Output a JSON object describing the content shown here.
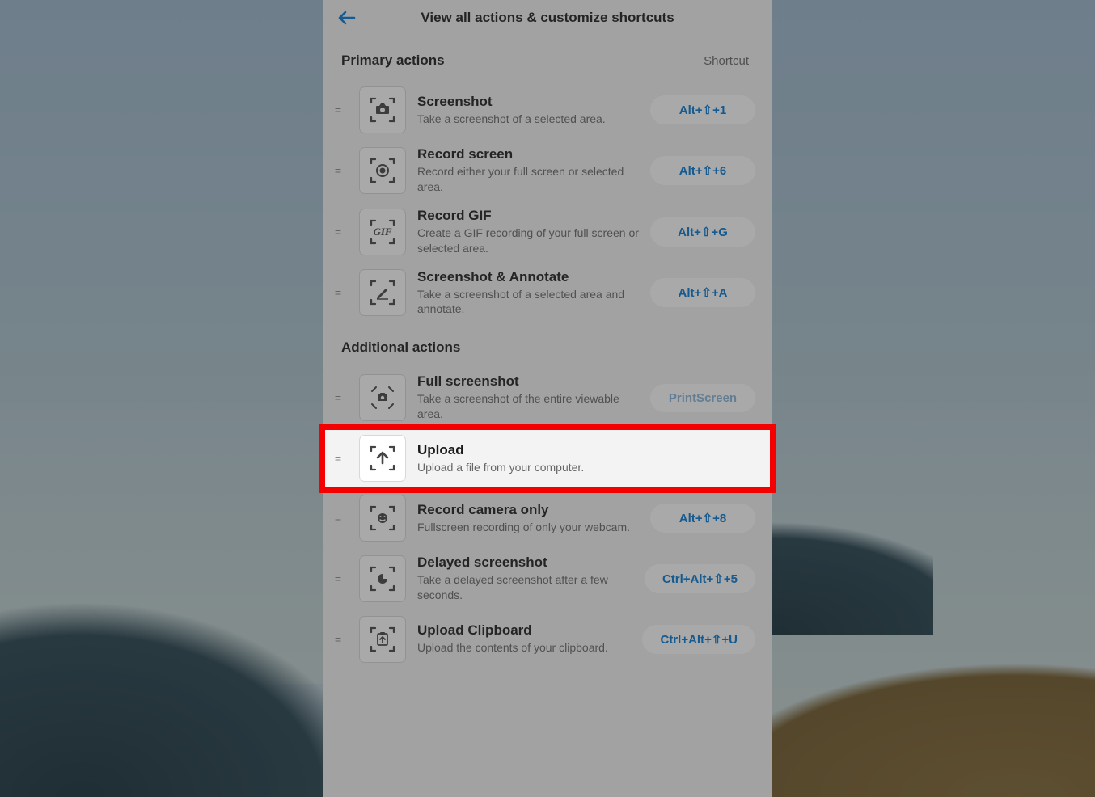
{
  "header": {
    "title": "View all actions & customize shortcuts"
  },
  "sections": {
    "primary": {
      "title": "Primary actions",
      "shortcut_col": "Shortcut"
    },
    "additional": {
      "title": "Additional actions"
    }
  },
  "actions": {
    "screenshot": {
      "title": "Screenshot",
      "desc": "Take a screenshot of a selected area.",
      "shortcut": "Alt+⇧+1"
    },
    "record_screen": {
      "title": "Record screen",
      "desc": "Record either your full screen or selected area.",
      "shortcut": "Alt+⇧+6"
    },
    "record_gif": {
      "title": "Record GIF",
      "desc": "Create a GIF recording of your full screen or selected area.",
      "shortcut": "Alt+⇧+G"
    },
    "screenshot_annotate": {
      "title": "Screenshot & Annotate",
      "desc": "Take a screenshot of a selected area and annotate.",
      "shortcut": "Alt+⇧+A"
    },
    "full_screenshot": {
      "title": "Full screenshot",
      "desc": "Take a screenshot of the entire viewable area.",
      "shortcut": "PrintScreen"
    },
    "upload": {
      "title": "Upload",
      "desc": "Upload a file from your computer."
    },
    "record_camera": {
      "title": "Record camera only",
      "desc": "Fullscreen recording of only your webcam.",
      "shortcut": "Alt+⇧+8"
    },
    "delayed_screenshot": {
      "title": "Delayed screenshot",
      "desc": "Take a delayed screenshot after a few seconds.",
      "shortcut": "Ctrl+Alt+⇧+5"
    },
    "upload_clipboard": {
      "title": "Upload Clipboard",
      "desc": "Upload the contents of your clipboard.",
      "shortcut": "Ctrl+Alt+⇧+U"
    }
  },
  "icon_gif_text": "GIF",
  "highlight_target": "upload"
}
